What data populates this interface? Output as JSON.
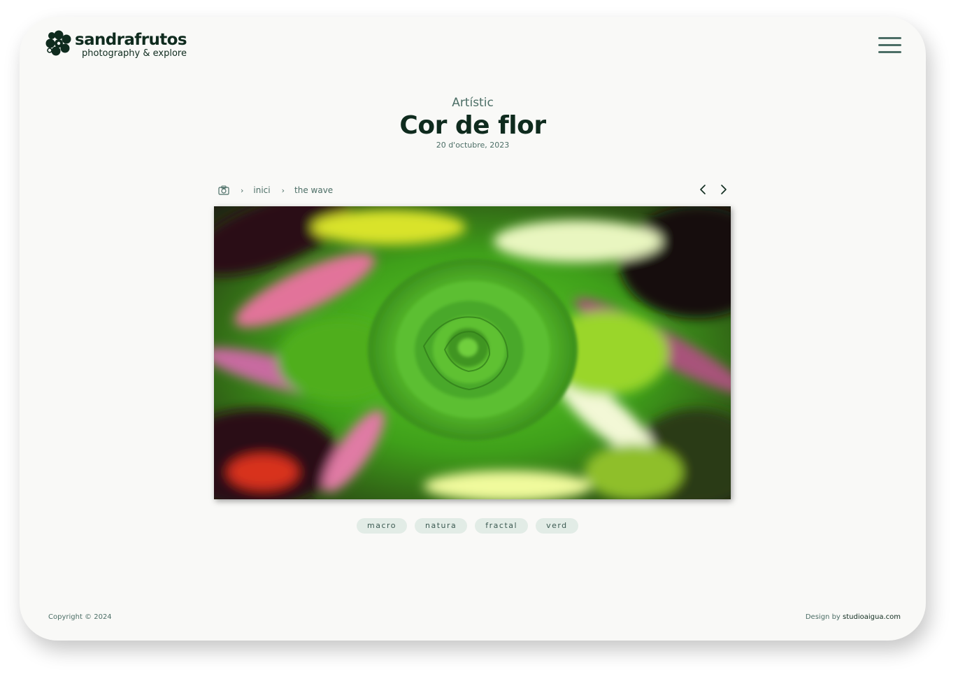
{
  "brand": {
    "name": "sandrafrutos",
    "tagline": "photography & explore",
    "color": "#0f2b1e",
    "accent": "#4c6e66"
  },
  "header": {
    "menu_icon": "hamburger-menu-icon"
  },
  "post": {
    "category": "Artístic",
    "title": "Cor de flor",
    "date": "20 d'octubre, 2023"
  },
  "breadcrumb": {
    "icon": "camera-icon",
    "items": [
      "inici",
      "the wave"
    ]
  },
  "pager": {
    "prev_icon": "chevron-left-icon",
    "next_icon": "chevron-right-icon"
  },
  "tags": [
    "macro",
    "natura",
    "fractal",
    "verd"
  ],
  "footer": {
    "copyright": "Copyright © 2024",
    "design_label": "Design by",
    "design_link": "studioaigua.com"
  }
}
